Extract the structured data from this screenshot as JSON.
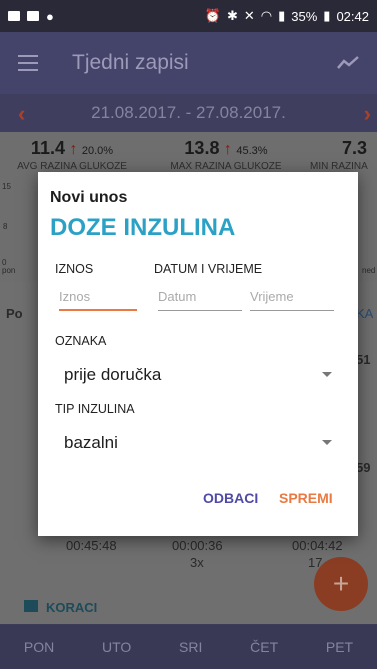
{
  "status_bar": {
    "battery": "35%",
    "time": "02:42"
  },
  "app_bar": {
    "title": "Tjedni zapisi"
  },
  "date_range": "21.08.2017. - 27.08.2017.",
  "stats": [
    {
      "value": "11.4",
      "change": "20.0%",
      "label": "AVG RAZINA GLUKOZE"
    },
    {
      "value": "13.8",
      "change": "45.3%",
      "label": "MAX RAZINA GLUKOZE"
    },
    {
      "value": "7.3",
      "change": "",
      "label": "MIN RAZINA"
    }
  ],
  "chart_axis": {
    "y_top": "15",
    "y_mid": "8",
    "y_bottom": "0",
    "x_first": "pon",
    "x_last": "ned"
  },
  "background_rows": {
    "row1_title": "Po",
    "row1_right": "KA",
    "row1_value": "51",
    "row2_value": "59",
    "durations": [
      "00:45:48",
      "00:00:36",
      "00:04:42"
    ],
    "count": "3x",
    "count2": "17",
    "section_label": "KORACI"
  },
  "dialog": {
    "subtitle": "Novi unos",
    "title": "DOZE INZULINA",
    "amount_label": "IZNOS",
    "datetime_label": "DATUM I VRIJEME",
    "amount_placeholder": "Iznos",
    "date_placeholder": "Datum",
    "time_placeholder": "Vrijeme",
    "tag_label": "OZNAKA",
    "tag_value": "prije doručka",
    "type_label": "TIP INZULINA",
    "type_value": "bazalni",
    "cancel": "ODBACI",
    "save": "SPREMI"
  },
  "bottom_nav": [
    "PON",
    "UTO",
    "SRI",
    "ČET",
    "PET"
  ],
  "colors": {
    "accent": "#ea7a42",
    "title": "#2ca1c6",
    "cancel": "#4f4aa3",
    "appbar": "#44436a"
  }
}
